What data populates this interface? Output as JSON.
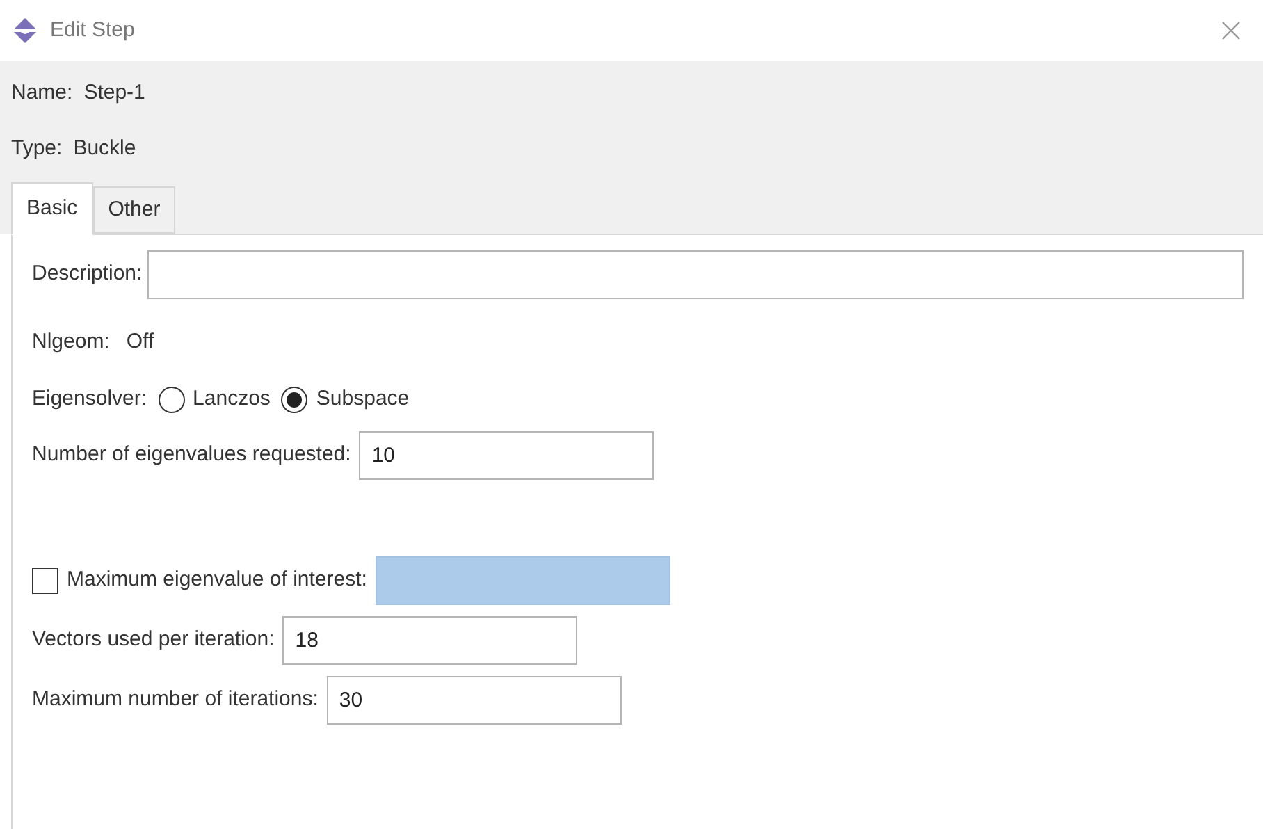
{
  "window": {
    "title": "Edit Step"
  },
  "name": {
    "label": "Name:",
    "value": "Step-1"
  },
  "type": {
    "label": "Type:",
    "value": "Buckle"
  },
  "tabs": [
    {
      "label": "Basic",
      "selected": true
    },
    {
      "label": "Other",
      "selected": false
    }
  ],
  "description": {
    "label": "Description:"
  },
  "nlgeom": {
    "label": "Nlgeom:",
    "value": "Off"
  },
  "eigensolver": {
    "label": "Eigensolver:",
    "options": [
      {
        "label": "Lanczos",
        "selected": false
      },
      {
        "label": "Subspace",
        "selected": true
      }
    ]
  },
  "num_eigenvalues": {
    "label": "Number of eigenvalues requested:",
    "value": "10"
  },
  "max_eigenvalue": {
    "label": "Maximum eigenvalue of interest:",
    "checked": false,
    "disabled": true
  },
  "vectors": {
    "label": "Vectors used per iteration:",
    "value": "18"
  },
  "max_iterations": {
    "label": "Maximum number of iterations:",
    "value": "30"
  }
}
